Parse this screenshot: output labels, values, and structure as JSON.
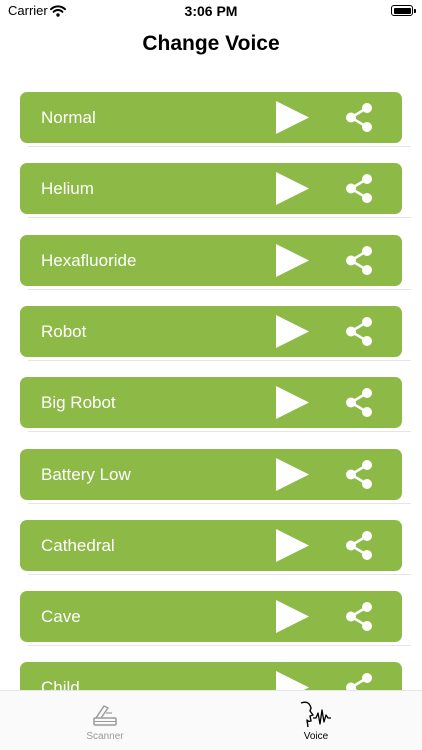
{
  "status_bar": {
    "carrier": "Carrier",
    "time": "3:06 PM"
  },
  "title": "Change Voice",
  "voices": [
    {
      "label": "Normal"
    },
    {
      "label": "Helium"
    },
    {
      "label": "Hexafluoride"
    },
    {
      "label": "Robot"
    },
    {
      "label": "Big Robot"
    },
    {
      "label": "Battery Low"
    },
    {
      "label": "Cathedral"
    },
    {
      "label": "Cave"
    },
    {
      "label": "Child"
    }
  ],
  "tabs": [
    {
      "label": "Scanner",
      "icon": "scanner-icon",
      "active": false
    },
    {
      "label": "Voice",
      "icon": "voice-icon",
      "active": true
    }
  ],
  "colors": {
    "accent": "#8db946",
    "tab_inactive": "#9b9b9b"
  }
}
